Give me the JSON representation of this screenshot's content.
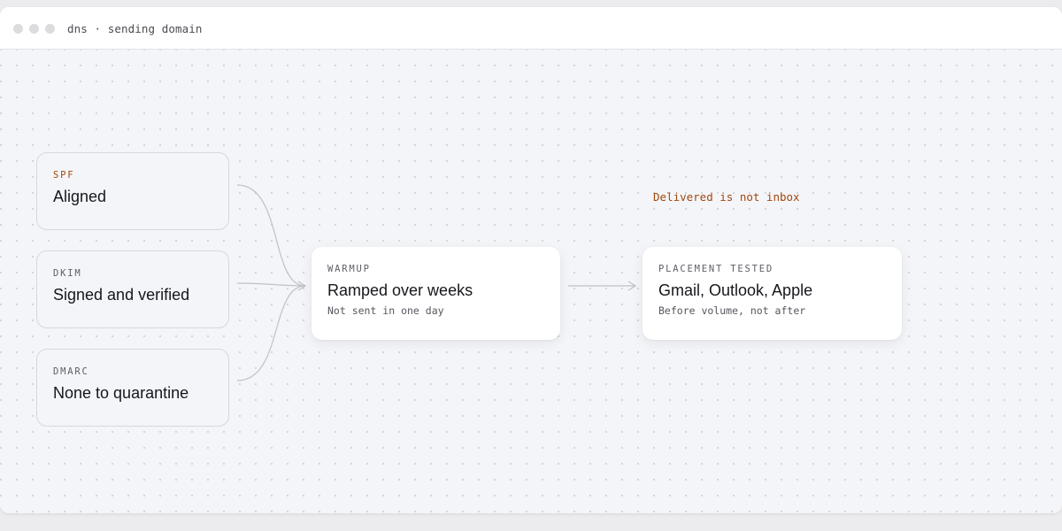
{
  "window": {
    "title": "dns · sending domain",
    "controls": [
      "close-dot",
      "minimize-dot",
      "maximize-dot"
    ]
  },
  "colors": {
    "accent": "#a0470f",
    "canvas": "#f4f5f8",
    "connector": "#bfc1c7"
  },
  "sources": [
    {
      "eyebrow": "SPF",
      "heading": "Aligned",
      "accent": true
    },
    {
      "eyebrow": "DKIM",
      "heading": "Signed and verified",
      "accent": false
    },
    {
      "eyebrow": "DMARC",
      "heading": "None to quarantine",
      "accent": false
    }
  ],
  "warmup": {
    "eyebrow": "WARMUP",
    "heading": "Ramped over weeks",
    "sub": "Not sent in one day"
  },
  "placement": {
    "eyebrow": "PLACEMENT TESTED",
    "heading": "Gmail, Outlook, Apple",
    "sub": "Before volume, not after"
  },
  "annotation": "Delivered is not inbox"
}
